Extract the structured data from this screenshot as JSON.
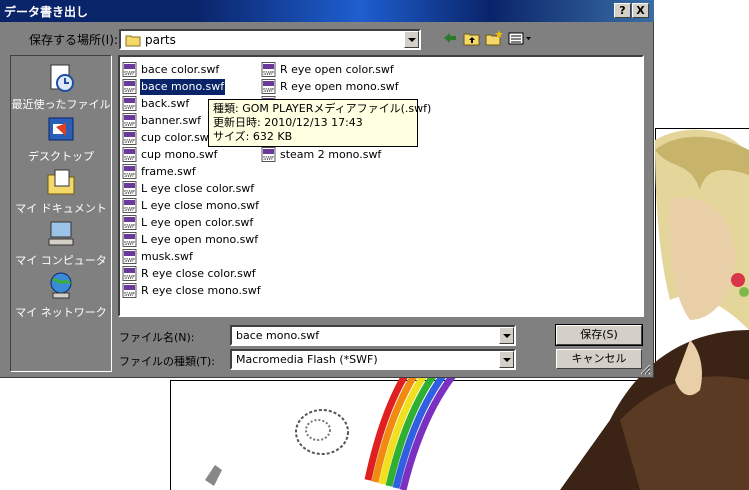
{
  "dialog": {
    "title": "データ書き出し",
    "help_button": "?",
    "close_button": "X",
    "save_in_label": "保存する場所(I):",
    "save_in_value": "parts"
  },
  "places": [
    {
      "label": "最近使ったファイル",
      "icon": "recent-files-icon"
    },
    {
      "label": "デスクトップ",
      "icon": "desktop-icon"
    },
    {
      "label": "マイ ドキュメント",
      "icon": "my-documents-icon"
    },
    {
      "label": "マイ コンピュータ",
      "icon": "my-computer-icon"
    },
    {
      "label": "マイ ネットワーク",
      "icon": "my-network-icon"
    }
  ],
  "files_col1": [
    "bace color.swf",
    "bace mono.swf",
    "back.swf",
    "banner.swf",
    "cup color.swf",
    "cup mono.swf",
    "frame.swf",
    "L eye close color.swf",
    "L eye close mono.swf",
    "L eye open color.swf",
    "L eye open mono.swf",
    "musk.swf",
    "R eye close color.swf",
    "R eye close mono.swf"
  ],
  "files_col2": [
    "R eye open color.swf",
    "R eye open mono.swf",
    "steam 1 color.swf",
    "",
    "",
    "steam 2 mono.swf"
  ],
  "selected_file": "bace mono.swf",
  "tooltip": {
    "line1": "種類: GOM PLAYERメディアファイル(.swf)",
    "line2": "更新日時: 2010/12/13 17:43",
    "line3": "サイズ: 632 KB"
  },
  "filename": {
    "label": "ファイル名(N):",
    "value": "bace mono.swf"
  },
  "filetype": {
    "label": "ファイルの種類(T):",
    "value": "Macromedia Flash (*SWF)"
  },
  "buttons": {
    "save": "保存(S)",
    "cancel": "キャンセル"
  },
  "colors": {
    "titlebar": "#0a246a",
    "selection": "#0a246a",
    "face": "#d4d0c8",
    "places_bg": "#808080",
    "tooltip_bg": "#ffffe1"
  }
}
